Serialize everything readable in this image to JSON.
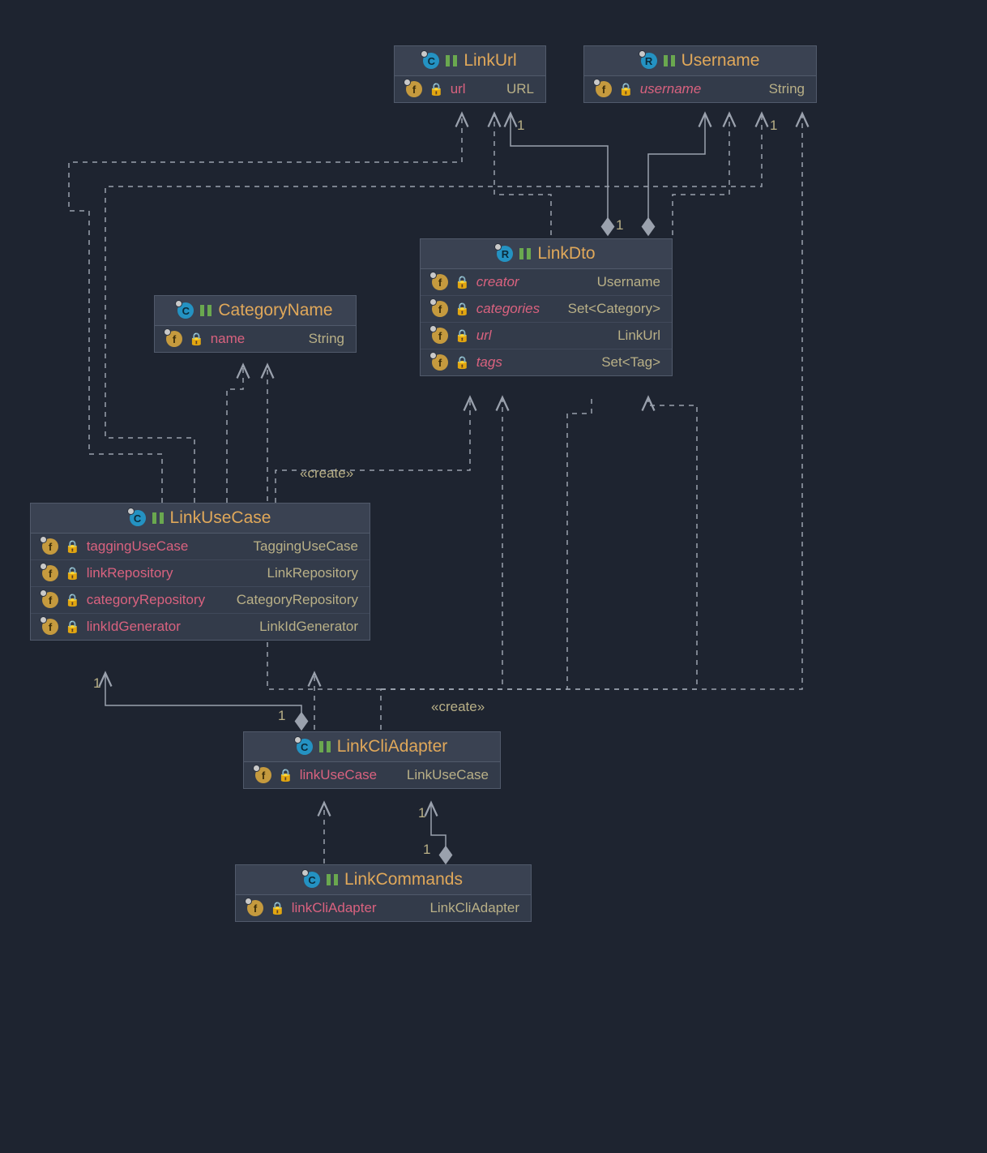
{
  "classes": {
    "linkUrl": {
      "kind": "C",
      "title": "LinkUrl",
      "fields": [
        {
          "name": "url",
          "type": "URL",
          "italic": false
        }
      ]
    },
    "username": {
      "kind": "R",
      "title": "Username",
      "fields": [
        {
          "name": "username",
          "type": "String",
          "italic": true
        }
      ]
    },
    "categoryName": {
      "kind": "C",
      "title": "CategoryName",
      "fields": [
        {
          "name": "name",
          "type": "String",
          "italic": false
        }
      ]
    },
    "linkDto": {
      "kind": "R",
      "title": "LinkDto",
      "fields": [
        {
          "name": "creator",
          "type": "Username",
          "italic": true
        },
        {
          "name": "categories",
          "type": "Set<Category>",
          "italic": true
        },
        {
          "name": "url",
          "type": "LinkUrl",
          "italic": true
        },
        {
          "name": "tags",
          "type": "Set<Tag>",
          "italic": true
        }
      ]
    },
    "linkUseCase": {
      "kind": "C",
      "title": "LinkUseCase",
      "fields": [
        {
          "name": "taggingUseCase",
          "type": "TaggingUseCase",
          "italic": false
        },
        {
          "name": "linkRepository",
          "type": "LinkRepository",
          "italic": false
        },
        {
          "name": "categoryRepository",
          "type": "CategoryRepository",
          "italic": false
        },
        {
          "name": "linkIdGenerator",
          "type": "LinkIdGenerator",
          "italic": false
        }
      ]
    },
    "linkCliAdapter": {
      "kind": "C",
      "title": "LinkCliAdapter",
      "fields": [
        {
          "name": "linkUseCase",
          "type": "LinkUseCase",
          "italic": false
        }
      ]
    },
    "linkCommands": {
      "kind": "C",
      "title": "LinkCommands",
      "fields": [
        {
          "name": "linkCliAdapter",
          "type": "LinkCliAdapter",
          "italic": false
        }
      ]
    }
  },
  "stereotypes": {
    "create1": "«create»",
    "create2": "«create»"
  },
  "multiplicities": {
    "m1": "1",
    "m2": "1",
    "m3": "1",
    "m4": "1",
    "m5": "1",
    "m6": "1",
    "m7": "1"
  }
}
